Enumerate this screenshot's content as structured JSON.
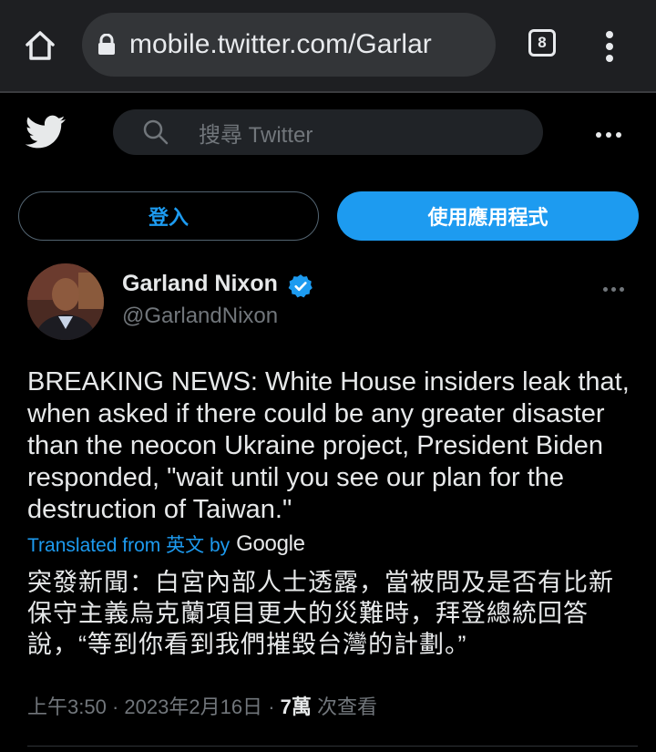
{
  "browser": {
    "url": "mobile.twitter.com/Garlar",
    "tab_count": "8"
  },
  "header": {
    "search_placeholder": "搜尋 Twitter",
    "login_label": "登入",
    "app_label": "使用應用程式"
  },
  "tweet": {
    "display_name": "Garland Nixon",
    "handle": "@GarlandNixon",
    "text": "BREAKING NEWS: White House insiders leak that, when asked if there could be any greater disaster than the neocon Ukraine project, President Biden responded, \"wait until you see our plan for the destruction of Taiwan.\"",
    "translated_prefix": "Translated from 英文 by",
    "translator": "Google",
    "translation": "突發新聞：白宮內部人士透露，當被問及是否有比新保守主義烏克蘭項目更大的災難時，拜登總統回答說，“等到你看到我們摧毀台灣的計劃。”",
    "time": "上午3:50",
    "date": "2023年2月16日",
    "views": "7萬",
    "views_label": "次查看"
  },
  "colors": {
    "accent": "#1d9bf0",
    "background": "#000000",
    "muted": "#71767b"
  },
  "icons": [
    "home-icon",
    "lock-icon",
    "tabs-icon",
    "browser-menu-icon",
    "twitter-bird-icon",
    "search-icon",
    "more-icon",
    "verified-badge-icon"
  ]
}
